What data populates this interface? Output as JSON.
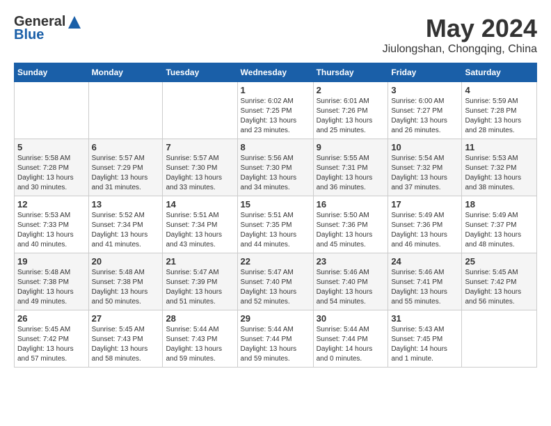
{
  "header": {
    "logo_general": "General",
    "logo_blue": "Blue",
    "month": "May 2024",
    "location": "Jiulongshan, Chongqing, China"
  },
  "weekdays": [
    "Sunday",
    "Monday",
    "Tuesday",
    "Wednesday",
    "Thursday",
    "Friday",
    "Saturday"
  ],
  "weeks": [
    [
      {
        "day": "",
        "info": ""
      },
      {
        "day": "",
        "info": ""
      },
      {
        "day": "",
        "info": ""
      },
      {
        "day": "1",
        "info": "Sunrise: 6:02 AM\nSunset: 7:25 PM\nDaylight: 13 hours\nand 23 minutes."
      },
      {
        "day": "2",
        "info": "Sunrise: 6:01 AM\nSunset: 7:26 PM\nDaylight: 13 hours\nand 25 minutes."
      },
      {
        "day": "3",
        "info": "Sunrise: 6:00 AM\nSunset: 7:27 PM\nDaylight: 13 hours\nand 26 minutes."
      },
      {
        "day": "4",
        "info": "Sunrise: 5:59 AM\nSunset: 7:28 PM\nDaylight: 13 hours\nand 28 minutes."
      }
    ],
    [
      {
        "day": "5",
        "info": "Sunrise: 5:58 AM\nSunset: 7:28 PM\nDaylight: 13 hours\nand 30 minutes."
      },
      {
        "day": "6",
        "info": "Sunrise: 5:57 AM\nSunset: 7:29 PM\nDaylight: 13 hours\nand 31 minutes."
      },
      {
        "day": "7",
        "info": "Sunrise: 5:57 AM\nSunset: 7:30 PM\nDaylight: 13 hours\nand 33 minutes."
      },
      {
        "day": "8",
        "info": "Sunrise: 5:56 AM\nSunset: 7:30 PM\nDaylight: 13 hours\nand 34 minutes."
      },
      {
        "day": "9",
        "info": "Sunrise: 5:55 AM\nSunset: 7:31 PM\nDaylight: 13 hours\nand 36 minutes."
      },
      {
        "day": "10",
        "info": "Sunrise: 5:54 AM\nSunset: 7:32 PM\nDaylight: 13 hours\nand 37 minutes."
      },
      {
        "day": "11",
        "info": "Sunrise: 5:53 AM\nSunset: 7:32 PM\nDaylight: 13 hours\nand 38 minutes."
      }
    ],
    [
      {
        "day": "12",
        "info": "Sunrise: 5:53 AM\nSunset: 7:33 PM\nDaylight: 13 hours\nand 40 minutes."
      },
      {
        "day": "13",
        "info": "Sunrise: 5:52 AM\nSunset: 7:34 PM\nDaylight: 13 hours\nand 41 minutes."
      },
      {
        "day": "14",
        "info": "Sunrise: 5:51 AM\nSunset: 7:34 PM\nDaylight: 13 hours\nand 43 minutes."
      },
      {
        "day": "15",
        "info": "Sunrise: 5:51 AM\nSunset: 7:35 PM\nDaylight: 13 hours\nand 44 minutes."
      },
      {
        "day": "16",
        "info": "Sunrise: 5:50 AM\nSunset: 7:36 PM\nDaylight: 13 hours\nand 45 minutes."
      },
      {
        "day": "17",
        "info": "Sunrise: 5:49 AM\nSunset: 7:36 PM\nDaylight: 13 hours\nand 46 minutes."
      },
      {
        "day": "18",
        "info": "Sunrise: 5:49 AM\nSunset: 7:37 PM\nDaylight: 13 hours\nand 48 minutes."
      }
    ],
    [
      {
        "day": "19",
        "info": "Sunrise: 5:48 AM\nSunset: 7:38 PM\nDaylight: 13 hours\nand 49 minutes."
      },
      {
        "day": "20",
        "info": "Sunrise: 5:48 AM\nSunset: 7:38 PM\nDaylight: 13 hours\nand 50 minutes."
      },
      {
        "day": "21",
        "info": "Sunrise: 5:47 AM\nSunset: 7:39 PM\nDaylight: 13 hours\nand 51 minutes."
      },
      {
        "day": "22",
        "info": "Sunrise: 5:47 AM\nSunset: 7:40 PM\nDaylight: 13 hours\nand 52 minutes."
      },
      {
        "day": "23",
        "info": "Sunrise: 5:46 AM\nSunset: 7:40 PM\nDaylight: 13 hours\nand 54 minutes."
      },
      {
        "day": "24",
        "info": "Sunrise: 5:46 AM\nSunset: 7:41 PM\nDaylight: 13 hours\nand 55 minutes."
      },
      {
        "day": "25",
        "info": "Sunrise: 5:45 AM\nSunset: 7:42 PM\nDaylight: 13 hours\nand 56 minutes."
      }
    ],
    [
      {
        "day": "26",
        "info": "Sunrise: 5:45 AM\nSunset: 7:42 PM\nDaylight: 13 hours\nand 57 minutes."
      },
      {
        "day": "27",
        "info": "Sunrise: 5:45 AM\nSunset: 7:43 PM\nDaylight: 13 hours\nand 58 minutes."
      },
      {
        "day": "28",
        "info": "Sunrise: 5:44 AM\nSunset: 7:43 PM\nDaylight: 13 hours\nand 59 minutes."
      },
      {
        "day": "29",
        "info": "Sunrise: 5:44 AM\nSunset: 7:44 PM\nDaylight: 13 hours\nand 59 minutes."
      },
      {
        "day": "30",
        "info": "Sunrise: 5:44 AM\nSunset: 7:44 PM\nDaylight: 14 hours\nand 0 minutes."
      },
      {
        "day": "31",
        "info": "Sunrise: 5:43 AM\nSunset: 7:45 PM\nDaylight: 14 hours\nand 1 minute."
      },
      {
        "day": "",
        "info": ""
      }
    ]
  ]
}
